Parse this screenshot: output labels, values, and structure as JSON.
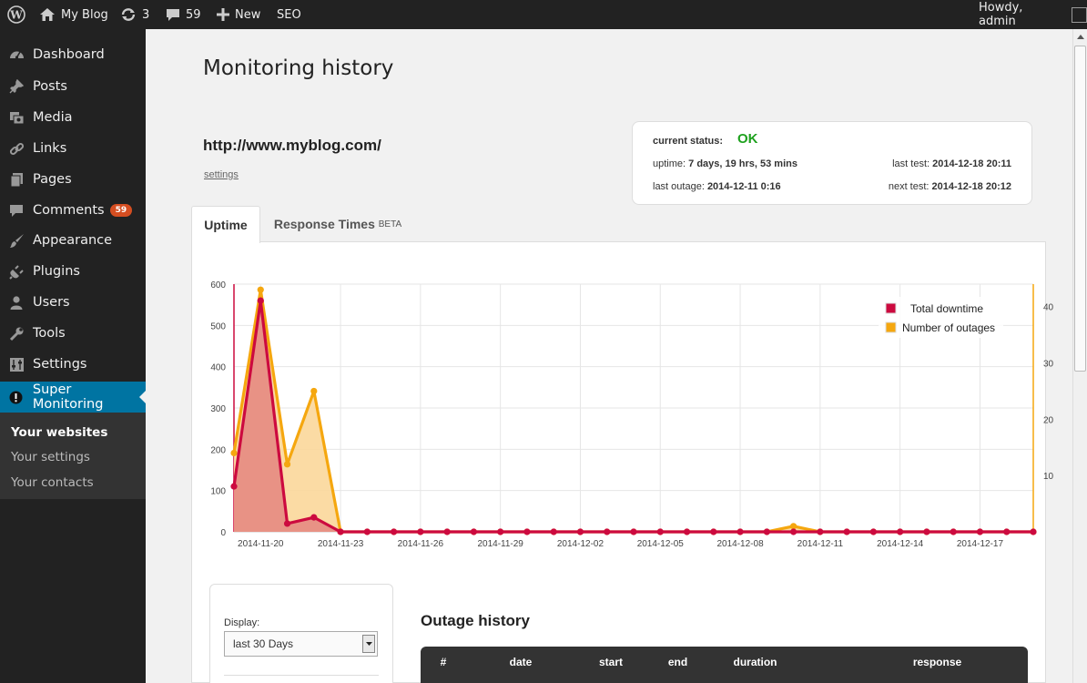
{
  "adminbar": {
    "site": "My Blog",
    "updates": "3",
    "comments": "59",
    "new": "New",
    "seo": "SEO",
    "howdy": "Howdy, admin"
  },
  "sidebar": {
    "items": [
      {
        "label": "Dashboard",
        "icon": "dashboard-icon"
      },
      {
        "label": "Posts",
        "icon": "pin-icon"
      },
      {
        "label": "Media",
        "icon": "media-icon"
      },
      {
        "label": "Links",
        "icon": "link-icon"
      },
      {
        "label": "Pages",
        "icon": "pages-icon"
      },
      {
        "label": "Comments",
        "icon": "comment-icon",
        "badge": "59"
      },
      {
        "label": "Appearance",
        "icon": "brush-icon"
      },
      {
        "label": "Plugins",
        "icon": "plug-icon"
      },
      {
        "label": "Users",
        "icon": "user-icon"
      },
      {
        "label": "Tools",
        "icon": "wrench-icon"
      },
      {
        "label": "Settings",
        "icon": "settings-icon"
      },
      {
        "label": "Super Monitoring",
        "icon": "alert-icon",
        "active": true
      }
    ],
    "submenu": [
      {
        "label": "Your websites",
        "current": true
      },
      {
        "label": "Your settings"
      },
      {
        "label": "Your contacts"
      }
    ]
  },
  "page": {
    "title": "Monitoring history",
    "url": "http://www.myblog.com/",
    "settings": "settings"
  },
  "status": {
    "label": "current status:",
    "value": "OK",
    "value_color": "#1ea11e",
    "uptime_label": "uptime:",
    "uptime": "7 days, 19 hrs, 53 mins",
    "last_test_label": "last test:",
    "last_test": "2014-12-18 20:11",
    "last_outage_label": "last outage:",
    "last_outage": "2014-12-11 0:16",
    "next_test_label": "next test:",
    "next_test": "2014-12-18 20:12"
  },
  "tabs": {
    "uptime": "Uptime",
    "response": "Response Times",
    "beta": "BETA"
  },
  "chart_data": {
    "type": "line",
    "x": [
      "2014-11-19",
      "2014-11-20",
      "2014-11-21",
      "2014-11-22",
      "2014-11-23",
      "2014-11-24",
      "2014-11-25",
      "2014-11-26",
      "2014-11-27",
      "2014-11-28",
      "2014-11-29",
      "2014-11-30",
      "2014-12-01",
      "2014-12-02",
      "2014-12-03",
      "2014-12-04",
      "2014-12-05",
      "2014-12-06",
      "2014-12-07",
      "2014-12-08",
      "2014-12-09",
      "2014-12-10",
      "2014-12-11",
      "2014-12-12",
      "2014-12-13",
      "2014-12-14",
      "2014-12-15",
      "2014-12-16",
      "2014-12-17",
      "2014-12-18",
      "2014-12-19"
    ],
    "xticks": [
      "2014-11-20",
      "2014-11-23",
      "2014-11-26",
      "2014-11-29",
      "2014-12-02",
      "2014-12-05",
      "2014-12-08",
      "2014-12-11",
      "2014-12-14",
      "2014-12-17"
    ],
    "series": [
      {
        "name": "Total downtime",
        "axis": "left",
        "color": "#cc0a3f",
        "fill": "#e58a82",
        "values": [
          110,
          560,
          20,
          35,
          0,
          0,
          0,
          0,
          0,
          0,
          0,
          0,
          0,
          0,
          0,
          0,
          0,
          0,
          0,
          0,
          0,
          0,
          0,
          0,
          0,
          0,
          0,
          0,
          0,
          0,
          0
        ]
      },
      {
        "name": "Number of outages",
        "axis": "right",
        "color": "#f5a70f",
        "fill": "#fbd79a",
        "values": [
          14,
          43,
          12,
          25,
          0,
          0,
          0,
          0,
          0,
          0,
          0,
          0,
          0,
          0,
          0,
          0,
          0,
          0,
          0,
          0,
          0,
          1,
          0,
          0,
          0,
          0,
          0,
          0,
          0,
          0,
          0
        ]
      }
    ],
    "ylim": [
      0,
      600
    ],
    "yticks": [
      0,
      100,
      200,
      300,
      400,
      500,
      600
    ],
    "y2lim": [
      0,
      44
    ],
    "y2ticks": [
      10,
      20,
      30,
      40
    ],
    "legend": "top-right",
    "grid": true
  },
  "display": {
    "label": "Display:",
    "selected": "last 30 Days"
  },
  "outages": {
    "title": "Outage history",
    "columns": [
      "#",
      "date",
      "start",
      "end",
      "duration",
      "response"
    ]
  }
}
